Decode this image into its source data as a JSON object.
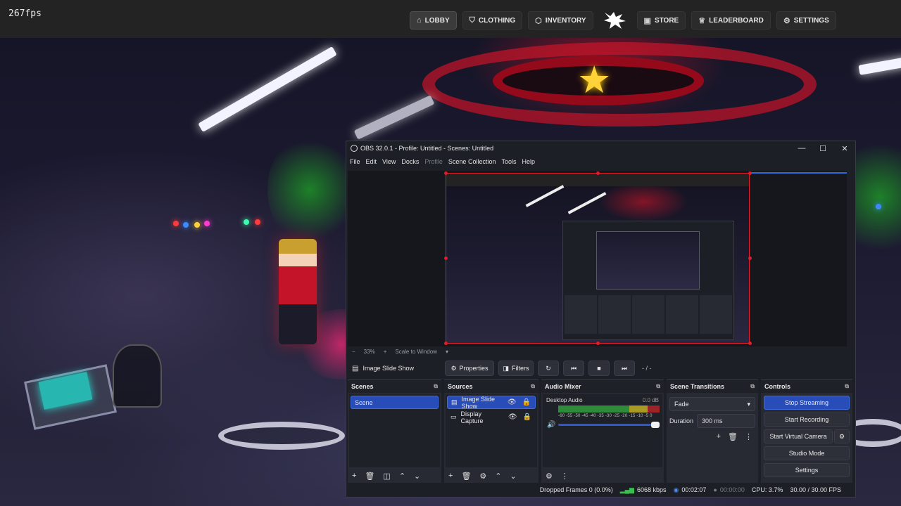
{
  "fps": "267fps",
  "nav": {
    "items": [
      {
        "icon": "home-icon",
        "glyph": "⌂",
        "label": "LOBBY",
        "active": true
      },
      {
        "icon": "shirt-icon",
        "glyph": "⛉",
        "label": "CLOTHING",
        "active": false
      },
      {
        "icon": "box-icon",
        "glyph": "⬡",
        "label": "INVENTORY",
        "active": false
      },
      {
        "icon": "store-icon",
        "glyph": "▣",
        "label": "STORE",
        "active": false
      },
      {
        "icon": "trophy-icon",
        "glyph": "♕",
        "label": "LEADERBOARD",
        "active": false
      },
      {
        "icon": "gear-icon",
        "glyph": "⚙",
        "label": "SETTINGS",
        "active": false
      }
    ]
  },
  "obs": {
    "title": "OBS 32.0.1 - Profile: Untitled - Scenes: Untitled",
    "menu": [
      "File",
      "Edit",
      "View",
      "Docks",
      "Profile",
      "Scene Collection",
      "Tools",
      "Help"
    ],
    "zoom": {
      "minus": "−",
      "value": "33%",
      "plus": "+",
      "scale_label": "Scale to Window"
    },
    "toolbar": {
      "source_name": "Image Slide Show",
      "properties": "Properties",
      "filters": "Filters",
      "time": "- / -"
    },
    "scenes": {
      "title": "Scenes",
      "items": [
        "Scene"
      ]
    },
    "sources": {
      "title": "Sources",
      "items": [
        "Image Slide Show",
        "Display Capture"
      ]
    },
    "mixer": {
      "title": "Audio Mixer",
      "channel": "Desktop Audio",
      "level": "0.0 dB",
      "scale": "-60 -55 -50 -45 -40 -35 -30 -25 -20 -15 -10 -5 0",
      "volume": 1.0
    },
    "transitions": {
      "title": "Scene Transitions",
      "selected": "Fade",
      "duration_label": "Duration",
      "duration_value": "300 ms"
    },
    "controls": {
      "title": "Controls",
      "buttons": [
        "Stop Streaming",
        "Start Recording",
        "Start Virtual Camera",
        "Studio Mode",
        "Settings"
      ]
    },
    "status": {
      "dropped": "Dropped Frames 0 (0.0%)",
      "bitrate": "6068 kbps",
      "stream_time": "00:02:07",
      "record_time": "00:00:00",
      "cpu": "CPU: 3.7%",
      "fps": "30.00 / 30.00 FPS"
    },
    "colors": {
      "accent": "#284cb8",
      "selection_border": "#e11d2a",
      "meter_green": "#2e8b3a"
    }
  }
}
